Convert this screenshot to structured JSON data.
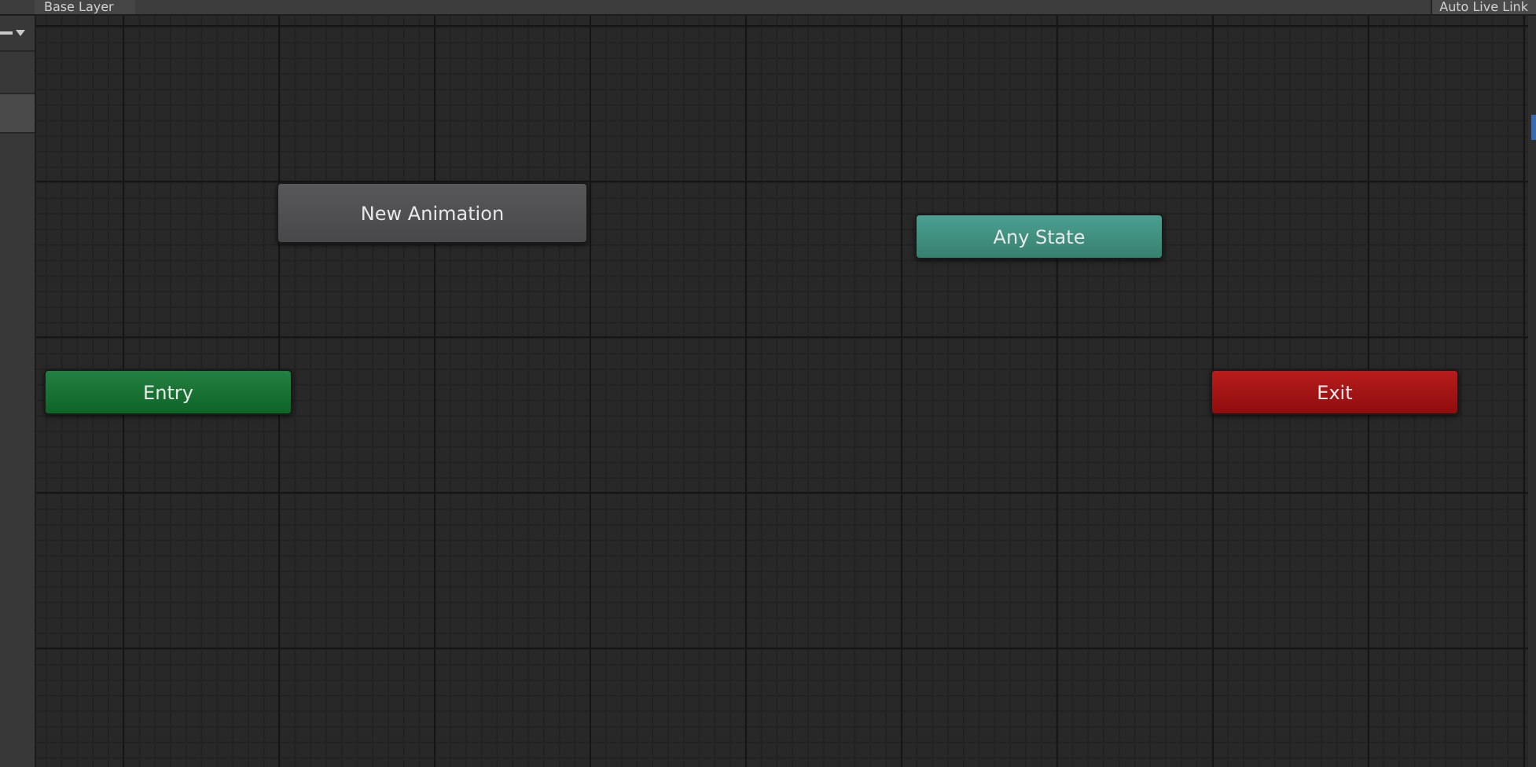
{
  "toolbar": {
    "breadcrumb": "Base Layer",
    "live_link_button": "Auto Live Link"
  },
  "nodes": [
    {
      "kind": "state",
      "label": "New Animation"
    },
    {
      "kind": "any",
      "label": "Any State"
    },
    {
      "kind": "entry",
      "label": "Entry"
    },
    {
      "kind": "exit",
      "label": "Exit"
    }
  ]
}
